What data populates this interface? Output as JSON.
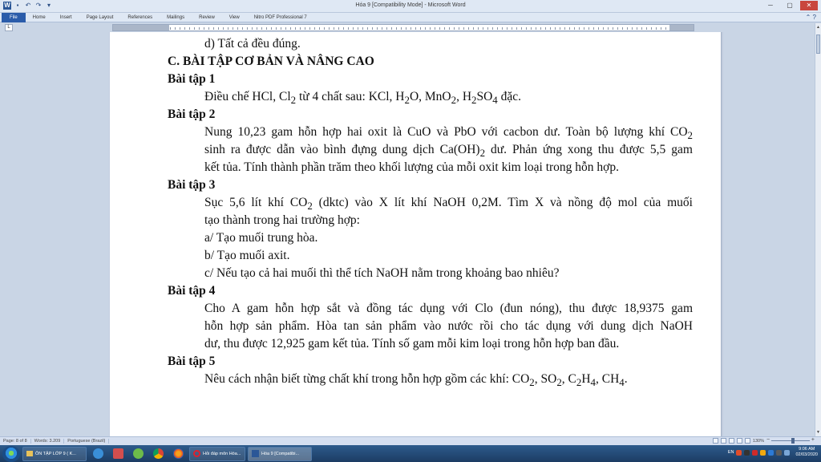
{
  "window": {
    "title": "Hóa 9 [Compatibility Mode] - Microsoft Word",
    "controls": [
      "─",
      "▢",
      "✕"
    ]
  },
  "ribbon": {
    "file_tab": "File",
    "tabs": [
      "Home",
      "Insert",
      "Page Layout",
      "References",
      "Mailings",
      "Review",
      "View",
      "Nitro PDF Professional 7"
    ]
  },
  "document": {
    "line_partial": "",
    "line_d": "d) Tất cả đều đúng.",
    "section_c": "C. BÀI TẬP CƠ BẢN VÀ NÂNG CAO",
    "ex1_title": "Bài tập 1",
    "ex1_html": "Điều chế HCl, Cl<sub>2</sub> từ 4 chất sau: KCl, H<sub>2</sub>O, MnO<sub>2</sub>, H<sub>2</sub>SO<sub>4</sub> đặc.",
    "ex2_title": "Bài tập 2",
    "ex2_l1": "Nung 10,23 gam hỗn hợp hai oxit là CuO và PbO với cacbon dư. Toàn bộ lượng khí CO<sub>2</sub>",
    "ex2_l2": "sinh ra được dẫn vào bình đựng dung dịch Ca(OH)<sub>2</sub> dư. Phản ứng xong thu được 5,5 gam",
    "ex2_l3": "kết tủa. Tính thành phần trăm theo khối lượng của mỗi oxit kim loại trong hỗn hợp.",
    "ex3_title": "Bài tập 3",
    "ex3_l1": "Sục 5,6 lít khí CO<sub>2</sub> (dktc) vào X lít khí NaOH 0,2M. Tìm X và nồng độ mol của muối",
    "ex3_l2": "tạo thành trong hai trường hợp:",
    "ex3_a": "a/ Tạo muối trung hòa.",
    "ex3_b": "b/ Tạo muối axit.",
    "ex3_c": "c/ Nếu tạo cả hai muối thì thể tích NaOH nằm trong khoảng bao nhiêu?",
    "ex4_title": "Bài tập 4",
    "ex4_l1": "Cho A gam hỗn hợp sắt và đồng tác dụng với Clo (đun nóng), thu được 18,9375 gam",
    "ex4_l2": "hỗn hợp sản phẩm. Hòa tan sản phẩm vào nước rồi cho tác dụng với dung dịch NaOH",
    "ex4_l3": "dư, thu được 12,925 gam kết tủa. Tính số gam mỗi kim loại trong hỗn hợp ban đầu.",
    "ex5_title": "Bài tập 5",
    "ex5_html": "Nêu cách nhận biết từng chất khí trong hỗn hợp gồm các khí: CO<sub>2</sub>, SO<sub>2</sub>, C<sub>2</sub>H<sub>4</sub>, CH<sub>4</sub>."
  },
  "statusbar": {
    "page": "Page: 8 of 8",
    "words": "Words: 3.209",
    "language": "Portuguese (Brazil)",
    "zoom": "130%",
    "zoom_fraction": 0.56
  },
  "taskbar": {
    "item1": "ÔN TẬP LỚP 9 ( K...",
    "item2": "Hỏi đáp môn Hóa...",
    "item3": "Hóa 9 [Compatibi...",
    "lang": "EN",
    "time": "9:06 AM",
    "date": "02/03/2020"
  },
  "colors": {
    "word_blue": "#2a5caa",
    "close_red": "#c9463d",
    "taskbar": "#1c3c63"
  }
}
